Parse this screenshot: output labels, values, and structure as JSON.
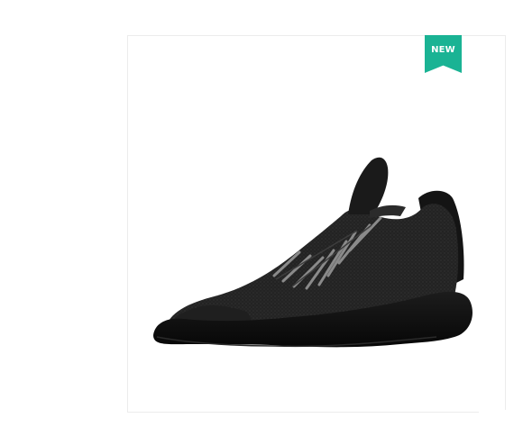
{
  "product_card": {
    "badge_label": "NEW",
    "badge_color": "#1ab394",
    "image_icon": "sneaker-image"
  }
}
